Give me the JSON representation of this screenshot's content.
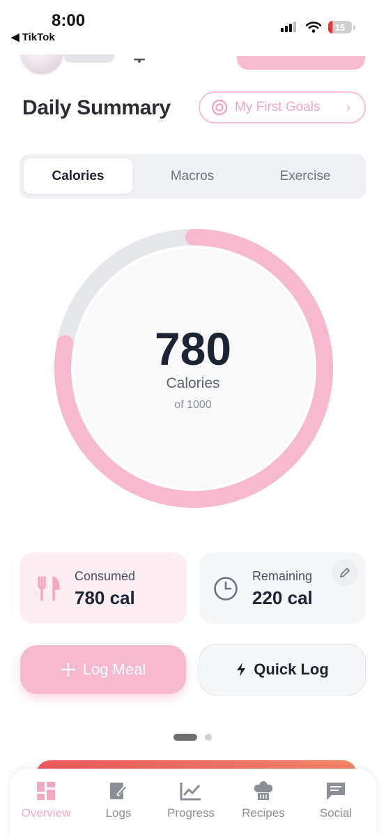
{
  "status_bar": {
    "time": "8:00",
    "back_app": "◀ TikTok",
    "battery": "15"
  },
  "header": {
    "title": "Daily Summary",
    "goals_button": "My First Goals"
  },
  "tabs": [
    {
      "label": "Calories",
      "active": true
    },
    {
      "label": "Macros",
      "active": false
    },
    {
      "label": "Exercise",
      "active": false
    }
  ],
  "ring": {
    "value": "780",
    "label": "Calories",
    "sub": "of 1000",
    "progress": 0.78
  },
  "stats": {
    "consumed": {
      "label": "Consumed",
      "value": "780 cal"
    },
    "remaining": {
      "label": "Remaining",
      "value": "220 cal"
    }
  },
  "actions": {
    "log_meal": "Log Meal",
    "quick_log": "Quick Log"
  },
  "pager": {
    "pages": 2,
    "current": 1
  },
  "nav": [
    {
      "label": "Overview",
      "icon": "dashboard-icon",
      "active": true
    },
    {
      "label": "Logs",
      "icon": "edit-log-icon",
      "active": false
    },
    {
      "label": "Progress",
      "icon": "chart-line-icon",
      "active": false
    },
    {
      "label": "Recipes",
      "icon": "chef-hat-icon",
      "active": false
    },
    {
      "label": "Social",
      "icon": "chat-icon",
      "active": false
    }
  ],
  "colors": {
    "accent": "#f6b9cd",
    "accent_text": "#f3a9c1",
    "ring_track": "#e5e7eb",
    "text_dark": "#1c2433"
  }
}
